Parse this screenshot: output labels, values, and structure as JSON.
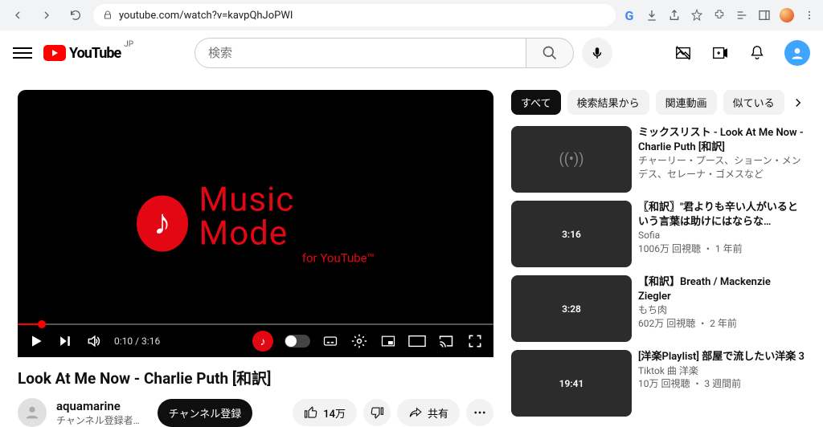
{
  "browser": {
    "url": "youtube.com/watch?v=kavpQhJoPWI"
  },
  "header": {
    "logo_text": "YouTube",
    "country_code": "JP",
    "search_placeholder": "検索"
  },
  "player": {
    "music_mode_big": "Music Mode",
    "music_mode_small": "for YouTube™",
    "timecode": "0:10 / 3:16"
  },
  "video": {
    "title": "Look At Me Now - Charlie Puth [和訳]",
    "channel_name": "aquamarine",
    "channel_subs": "チャンネル登録者…",
    "subscribe_label": "チャンネル登録",
    "like_count": "14万",
    "share_label": "共有"
  },
  "chips": [
    "すべて",
    "検索結果から",
    "関連動画",
    "似ている"
  ],
  "recommendations": [
    {
      "title": "ミックスリスト - Look At Me Now - Charlie Puth [和訳]",
      "channel": "チャーリー・プース、ショーン・メンデス、セレーナ・ゴメスなど",
      "meta": "",
      "duration": "",
      "is_mix": true
    },
    {
      "title": "〖和訳〗\"君よりも辛い人がいるという言葉は助けにはならな…",
      "channel": "Sofia",
      "meta": "1006万 回視聴 ・ 1 年前",
      "duration": "3:16",
      "is_mix": false
    },
    {
      "title": "【和訳】Breath / Mackenzie Ziegler",
      "channel": "もち肉",
      "meta": "602万 回視聴 ・ 2 年前",
      "duration": "3:28",
      "is_mix": false
    },
    {
      "title": "[洋楽Playlist] 部屋で流したい洋楽 3",
      "channel": "Tiktok 曲 洋楽",
      "meta": "10万 回視聴 ・ 3 週間前",
      "duration": "19:41",
      "is_mix": false
    }
  ]
}
